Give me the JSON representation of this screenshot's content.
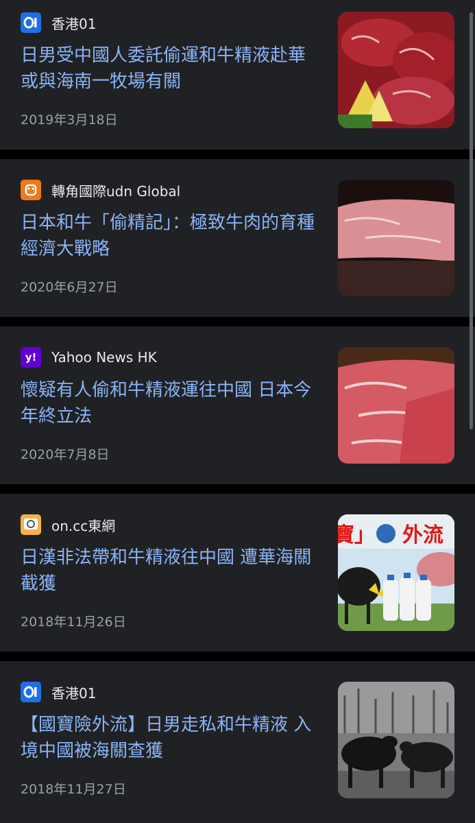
{
  "articles": [
    {
      "source": "香港01",
      "title": "日男受中國人委託偷運和牛精液赴華 或與海南一牧場有關",
      "date": "2019年3月18日",
      "logo": "01-logo-icon"
    },
    {
      "source": "轉角國際udn Global",
      "title": "日本和牛「偷精記」：極致牛肉的育種經濟大戰略",
      "date": "2020年6月27日",
      "logo": "udn-logo-icon"
    },
    {
      "source": "Yahoo News HK",
      "title": "懷疑有人偷和牛精液運往中國 日本今年終立法",
      "date": "2020年7月8日",
      "logo": "yahoo-logo-icon"
    },
    {
      "source": "on.cc東網",
      "title": "日漢非法帶和牛精液往中國 遭華海關截獲",
      "date": "2018年11月26日",
      "logo": "oncc-logo-icon",
      "thumb_text_left": "寶」",
      "thumb_text_right": "外流"
    },
    {
      "source": "香港01",
      "title": "【國寶險外流】日男走私和牛精液 入境中國被海關查獲",
      "date": "2018年11月27日",
      "logo": "01-logo-icon"
    }
  ],
  "colors": {
    "background": "#202124",
    "title": "#8ab4f8",
    "source": "#e8eaed",
    "date": "#9aa0a6"
  }
}
